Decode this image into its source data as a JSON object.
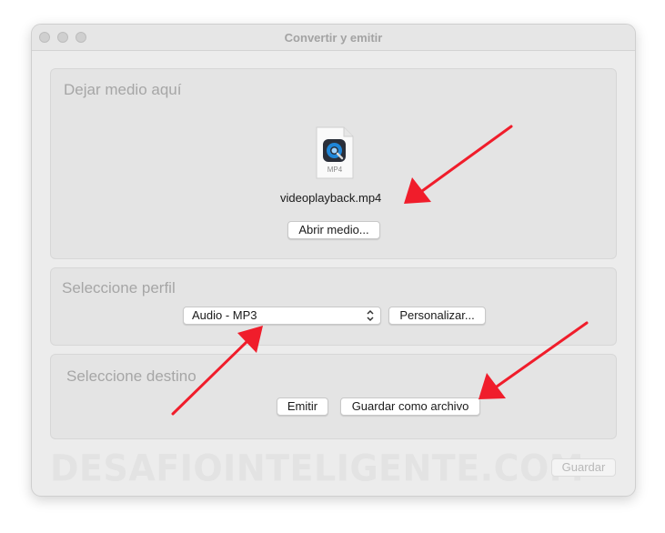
{
  "window": {
    "title": "Convertir y emitir"
  },
  "drop_section": {
    "title": "Dejar medio aquí",
    "file_icon_label": "MP4",
    "file_name": "videoplayback.mp4",
    "open_button": "Abrir medio..."
  },
  "profile_section": {
    "title": "Seleccione perfil",
    "selected_profile": "Audio - MP3",
    "customize_button": "Personalizar..."
  },
  "destination_section": {
    "title": "Seleccione destino",
    "stream_button": "Emitir",
    "save_as_file_button": "Guardar como archivo"
  },
  "footer": {
    "watermark": "DESAFIOINTELIGENTE.COM",
    "save_button": "Guardar"
  },
  "colors": {
    "annotation_arrow": "#f01d2b",
    "window_bg": "#ececec"
  },
  "icons": [
    "close-icon",
    "minimize-icon",
    "zoom-icon",
    "quicktime-file-icon",
    "chevron-updown-icon",
    "annotation-arrow"
  ]
}
